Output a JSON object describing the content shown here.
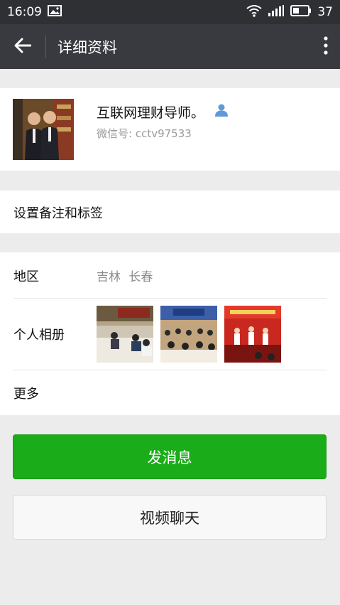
{
  "status": {
    "time": "16:09",
    "battery": "37"
  },
  "appbar": {
    "title": "详细资料"
  },
  "profile": {
    "name": "互联网理财导师。",
    "wechat_id": "微信号: cctv97533"
  },
  "remark": {
    "label": "设置备注和标签"
  },
  "info": {
    "region_label": "地区",
    "region_value": "吉林  长春",
    "album_label": "个人相册",
    "more_label": "更多"
  },
  "buttons": {
    "send_message": "发消息",
    "video_chat": "视频聊天"
  },
  "colors": {
    "primary_green": "#1aad19",
    "appbar": "#393a3f",
    "statusbar": "#2f3033",
    "contact_icon": "#5e9ad8"
  },
  "icons": [
    "image-icon",
    "wifi-icon",
    "signal-icon",
    "battery-icon",
    "back-arrow-icon",
    "more-vert-icon",
    "contact-icon"
  ]
}
